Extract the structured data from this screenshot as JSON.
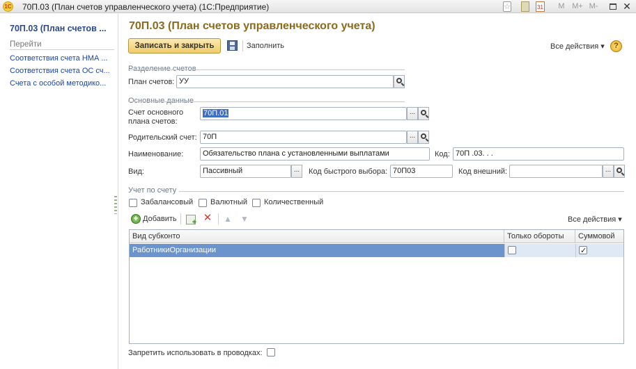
{
  "window": {
    "title": "70П.03 (План счетов управленческого учета)  (1С:Предприятие)",
    "logo_text": "1С",
    "buttons": [
      "M",
      "M+",
      "M-"
    ]
  },
  "sidebar": {
    "title": "70П.03 (План счетов ...",
    "section": "Перейти",
    "links": [
      "Соответствия счета НМА ...",
      "Соответствия счета ОС сч...",
      "Счета с особой методико..."
    ]
  },
  "header": {
    "title": "70П.03 (План счетов управленческого учета)",
    "save_close_label": "Записать и закрыть",
    "fill_label": "Заполнить",
    "all_actions_label": "Все действия ▾",
    "help_label": "?"
  },
  "section_split": {
    "title": "Разделение счетов",
    "plan_label": "План счетов:",
    "plan_value": "УУ"
  },
  "section_main": {
    "title": "Основные данные",
    "main_account_label_1": "Счет основного",
    "main_account_label_2": "плана счетов:",
    "main_account_value": "70П.01",
    "parent_label": "Родительский счет:",
    "parent_value": "70П",
    "name_label": "Наименование:",
    "name_value": "Обязательство плана с установленными выплатами",
    "code_label": "Код:",
    "code_value": "70П .03.  .  .",
    "type_label": "Вид:",
    "type_value": "Пассивный",
    "quick_code_label": "Код быстрого выбора:",
    "quick_code_value": "70П03",
    "ext_code_label": "Код внешний:",
    "ext_code_value": ""
  },
  "section_account": {
    "title": "Учет по счету",
    "off_balance_label": "Забалансовый",
    "currency_label": "Валютный",
    "quantity_label": "Количественный",
    "add_label": "Добавить",
    "all_actions_label": "Все действия ▾"
  },
  "table": {
    "columns": [
      "Вид субконто",
      "Только обороты",
      "Суммовой"
    ],
    "rows": [
      {
        "kind": "РаботникиОрганизации",
        "turnover_only": false,
        "sum": true
      }
    ]
  },
  "footer": {
    "forbid_label": "Запретить использовать в проводках:"
  }
}
